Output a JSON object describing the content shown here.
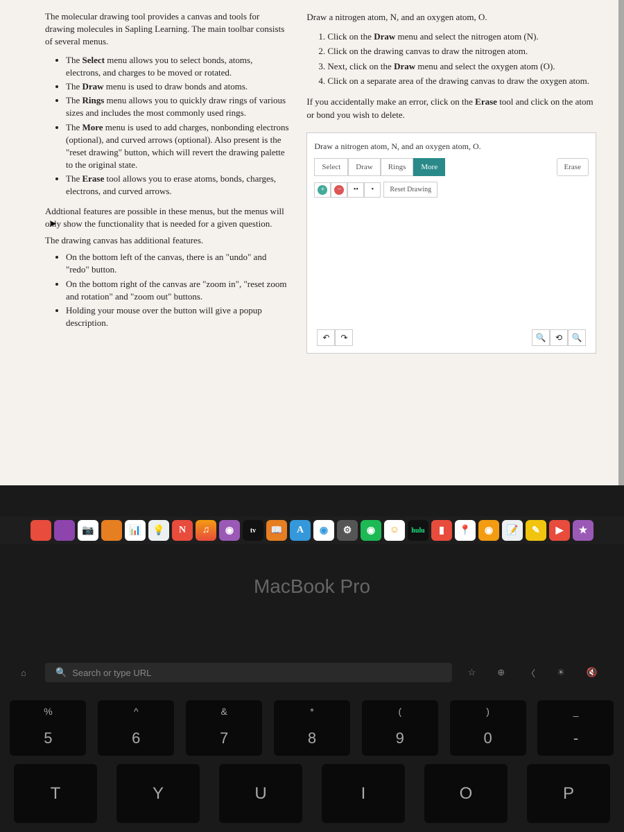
{
  "left": {
    "intro": "The molecular drawing tool provides a canvas and tools for drawing molecules in Sapling Learning. The main toolbar consists of several menus.",
    "bullets": [
      "The <b>Select</b> menu allows you to select bonds, atoms, electrons, and charges to be moved or rotated.",
      "The <b>Draw</b> menu is used to draw bonds and atoms.",
      "The <b>Rings</b> menu allows you to quickly draw rings of various sizes and includes the most commonly used rings.",
      "The <b>More</b> menu is used to add charges, nonbonding electrons (optional), and curved arrows (optional). Also present is the \"reset drawing\" button, which will revert the drawing palette to the original state.",
      "The <b>Erase</b> tool allows you to erase atoms, bonds, charges, electrons, and curved arrows."
    ],
    "subtext1": "Addtional features are possible in these menus, but the menus will only show the functionality that is needed for a given question.",
    "subtext2": "The drawing canvas has additional features.",
    "bullets2": [
      "On the bottom left of the canvas, there is an \"undo\" and \"redo\" button.",
      "On the bottom right of the canvas are \"zoom in\", \"reset zoom and rotation\" and \"zoom out\" buttons.",
      "Holding your mouse over the button will give a popup description."
    ]
  },
  "right": {
    "instruction": "Draw a nitrogen atom, N, and an oxygen atom, O.",
    "steps": [
      "Click on the <b>Draw</b> menu and select the nitrogen atom (N).",
      "Click on the drawing canvas to draw the nitrogen atom.",
      "Next, click on the <b>Draw</b> menu and select the oxygen atom (O).",
      "Click on a separate area of the drawing canvas to draw the oxygen atom."
    ],
    "note": "If you accidentally make an error, click on the <b>Erase</b> tool and click on the atom or bond you wish to delete.",
    "canvas_title": "Draw a nitrogen atom, N, and an oxygen atom, O.",
    "toolbar": {
      "select": "Select",
      "draw": "Draw",
      "rings": "Rings",
      "more": "More",
      "erase": "Erase",
      "reset": "Reset Drawing"
    }
  },
  "laptop": "MacBook Pro",
  "touchbar": {
    "search": "Search or type URL"
  },
  "dock": {
    "hulu": "hulu",
    "tv": "tv"
  },
  "keys": {
    "r1": [
      {
        "alt": "%",
        "main": "5"
      },
      {
        "alt": "^",
        "main": "6"
      },
      {
        "alt": "&",
        "main": "7"
      },
      {
        "alt": "*",
        "main": "8"
      },
      {
        "alt": "(",
        "main": "9"
      },
      {
        "alt": ")",
        "main": "0"
      },
      {
        "alt": "_",
        "main": "-"
      }
    ],
    "r2": [
      "T",
      "Y",
      "U",
      "I",
      "O",
      "P"
    ]
  }
}
